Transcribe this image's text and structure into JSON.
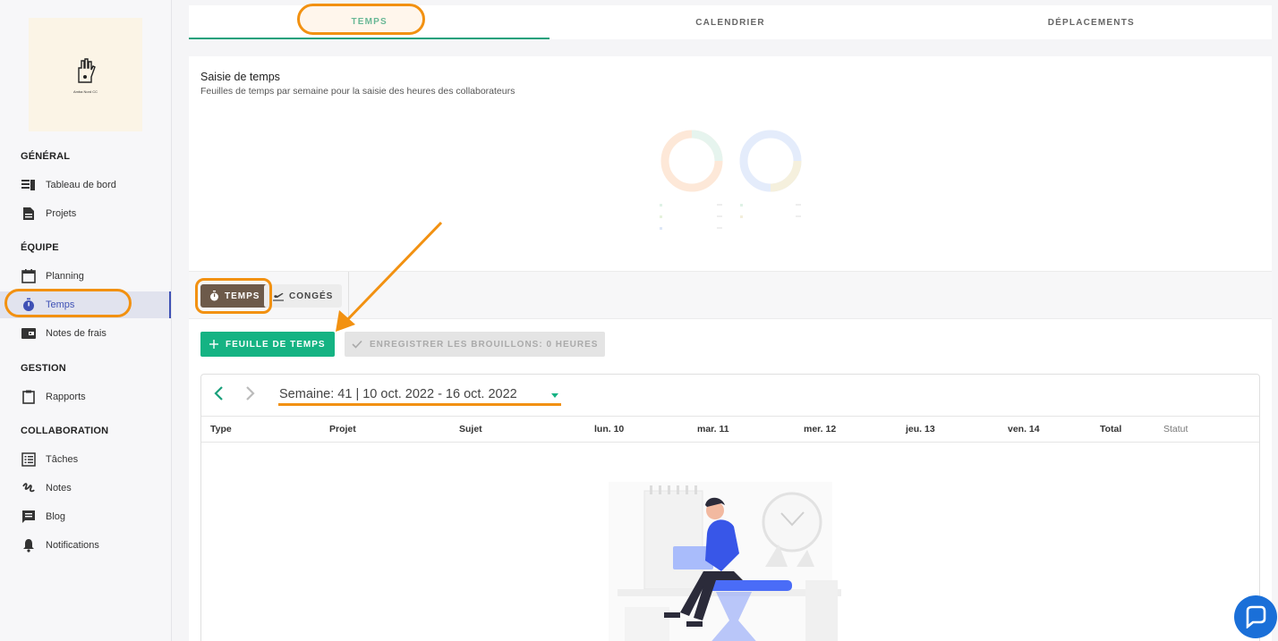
{
  "logo": {
    "caption": "Amba Nord CC"
  },
  "sidebar": {
    "sections": [
      {
        "title": "GÉNÉRAL",
        "items": [
          {
            "label": "Tableau de bord",
            "icon": "dashboard-icon"
          },
          {
            "label": "Projets",
            "icon": "document-icon"
          }
        ]
      },
      {
        "title": "ÉQUIPE",
        "items": [
          {
            "label": "Planning",
            "icon": "calendar-icon"
          },
          {
            "label": "Temps",
            "icon": "stopwatch-icon",
            "active": true
          },
          {
            "label": "Notes de frais",
            "icon": "wallet-icon"
          }
        ]
      },
      {
        "title": "GESTION",
        "items": [
          {
            "label": "Rapports",
            "icon": "clipboard-icon"
          }
        ]
      },
      {
        "title": "COLLABORATION",
        "items": [
          {
            "label": "Tâches",
            "icon": "list-icon"
          },
          {
            "label": "Notes",
            "icon": "scribble-icon"
          },
          {
            "label": "Blog",
            "icon": "blog-icon"
          },
          {
            "label": "Notifications",
            "icon": "bell-icon"
          }
        ]
      }
    ]
  },
  "top_tabs": [
    {
      "label": "TEMPS",
      "active": true
    },
    {
      "label": "CALENDRIER"
    },
    {
      "label": "DÉPLACEMENTS"
    }
  ],
  "card": {
    "title": "Saisie de temps",
    "subtitle": "Feuilles de temps par semaine pour la saisie des heures des collaborateurs"
  },
  "sub_tabs": [
    {
      "label": "TEMPS",
      "icon": "stopwatch-icon",
      "active": true
    },
    {
      "label": "CONGÉS",
      "icon": "plane-icon"
    }
  ],
  "actions": {
    "add_label": "FEUILLE DE TEMPS",
    "save_label": "ENREGISTRER LES BROUILLONS: 0 HEURES"
  },
  "week": {
    "label": "Semaine: 41 | 10 oct. 2022 - 16 oct. 2022"
  },
  "table": {
    "columns": [
      "Type",
      "Projet",
      "Sujet",
      "lun. 10",
      "mar. 11",
      "mer. 12",
      "jeu. 13",
      "ven. 14",
      "Total",
      "Statut"
    ]
  },
  "colors": {
    "accent_green": "#15b383",
    "highlight_orange": "#f29111",
    "active_nav": "#3f51b5",
    "subtab_active": "#6d5a4a",
    "chat_blue": "#1a6fd8"
  }
}
